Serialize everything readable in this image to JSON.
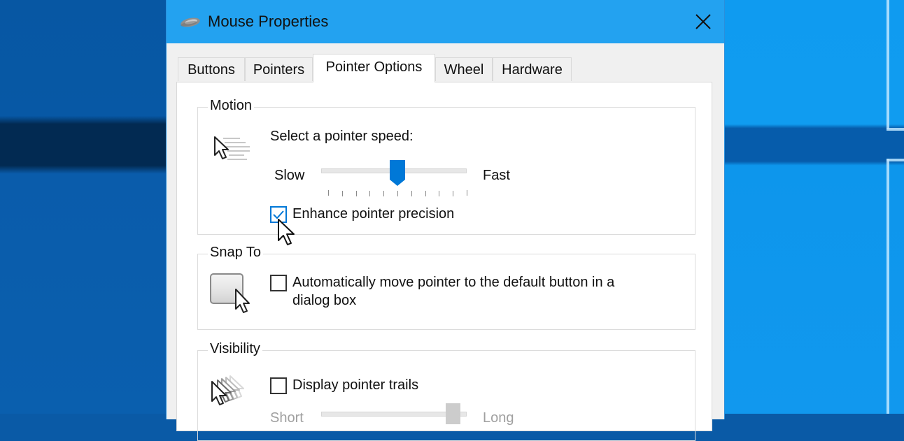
{
  "window": {
    "title": "Mouse Properties",
    "title_icon": "mouse-icon",
    "close_icon": "close-icon",
    "titlebar_color": "#23a2f0"
  },
  "tabs": [
    {
      "label": "Buttons",
      "active": false
    },
    {
      "label": "Pointers",
      "active": false
    },
    {
      "label": "Pointer Options",
      "active": true
    },
    {
      "label": "Wheel",
      "active": false
    },
    {
      "label": "Hardware",
      "active": false
    }
  ],
  "motion": {
    "group_label": "Motion",
    "icon": "pointer-speed-icon",
    "prompt": "Select a pointer speed:",
    "slow_label": "Slow",
    "fast_label": "Fast",
    "speed": {
      "value": 6,
      "min": 1,
      "max": 11,
      "tick_count": 11
    },
    "accent_color": "#0078d7",
    "enhance_precision": {
      "label": "Enhance pointer precision",
      "checked": true
    }
  },
  "snap_to": {
    "group_label": "Snap To",
    "icon": "snap-to-button-icon",
    "auto_move": {
      "label_line1": "Automatically move pointer to the default button in a",
      "label_line2": "dialog box",
      "checked": false
    }
  },
  "visibility": {
    "group_label": "Visibility",
    "icon": "pointer-trails-icon",
    "display_trails": {
      "label": "Display pointer trails",
      "checked": false
    },
    "trails_length": {
      "short_label": "Short",
      "long_label": "Long",
      "value_fraction": 0.9,
      "enabled": false
    }
  },
  "mouse_cursor": "arrow-cursor-icon"
}
